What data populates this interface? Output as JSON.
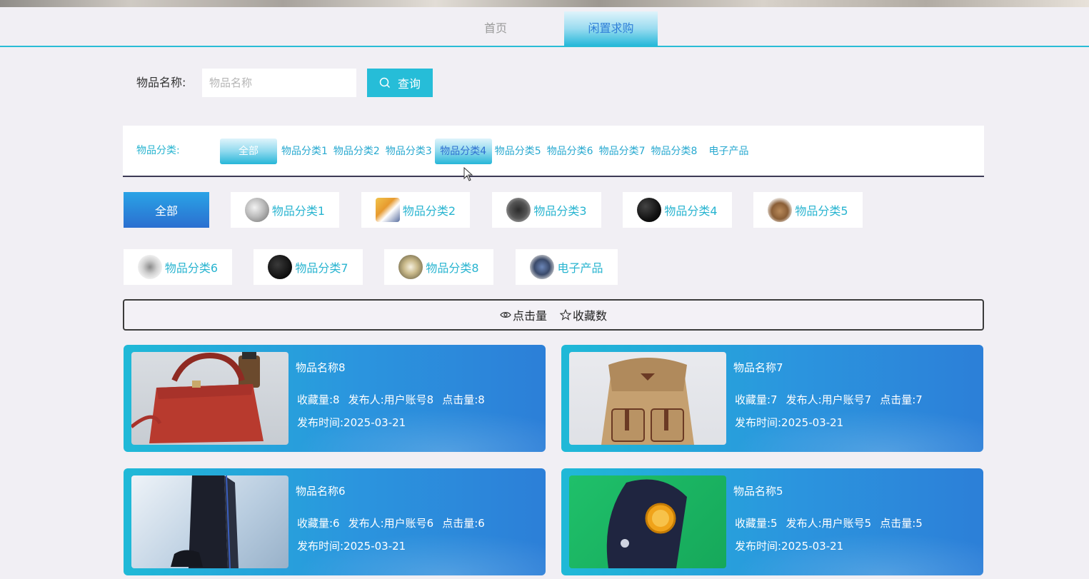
{
  "nav": {
    "items": [
      "首页",
      "闲置求购"
    ]
  },
  "search": {
    "label": "物品名称:",
    "placeholder": "物品名称",
    "button": "查询"
  },
  "category_bar": {
    "title": "物品分类:",
    "tags": [
      "全部",
      "物品分类1",
      "物品分类2",
      "物品分类3",
      "物品分类4",
      "物品分类5",
      "物品分类6",
      "物品分类7",
      "物品分类8",
      "电子产品"
    ]
  },
  "category_grid": {
    "items": [
      "全部",
      "物品分类1",
      "物品分类2",
      "物品分类3",
      "物品分类4",
      "物品分类5",
      "物品分类6",
      "物品分类7",
      "物品分类8",
      "电子产品"
    ]
  },
  "sort": {
    "clicks": "点击量",
    "favorites": "收藏数"
  },
  "cards": [
    {
      "name": "物品名称8",
      "fav": "收藏量:8",
      "publisher": "发布人:用户账号8",
      "clicks": "点击量:8",
      "time": "发布时间:2025-03-21"
    },
    {
      "name": "物品名称7",
      "fav": "收藏量:7",
      "publisher": "发布人:用户账号7",
      "clicks": "点击量:7",
      "time": "发布时间:2025-03-21"
    },
    {
      "name": "物品名称6",
      "fav": "收藏量:6",
      "publisher": "发布人:用户账号6",
      "clicks": "点击量:6",
      "time": "发布时间:2025-03-21"
    },
    {
      "name": "物品名称5",
      "fav": "收藏量:5",
      "publisher": "发布人:用户账号5",
      "clicks": "点击量:5",
      "time": "发布时间:2025-03-21"
    }
  ],
  "colors": {
    "accent": "#26bdd8",
    "blue": "#2b7fd8",
    "bg": "#f1eff4"
  }
}
